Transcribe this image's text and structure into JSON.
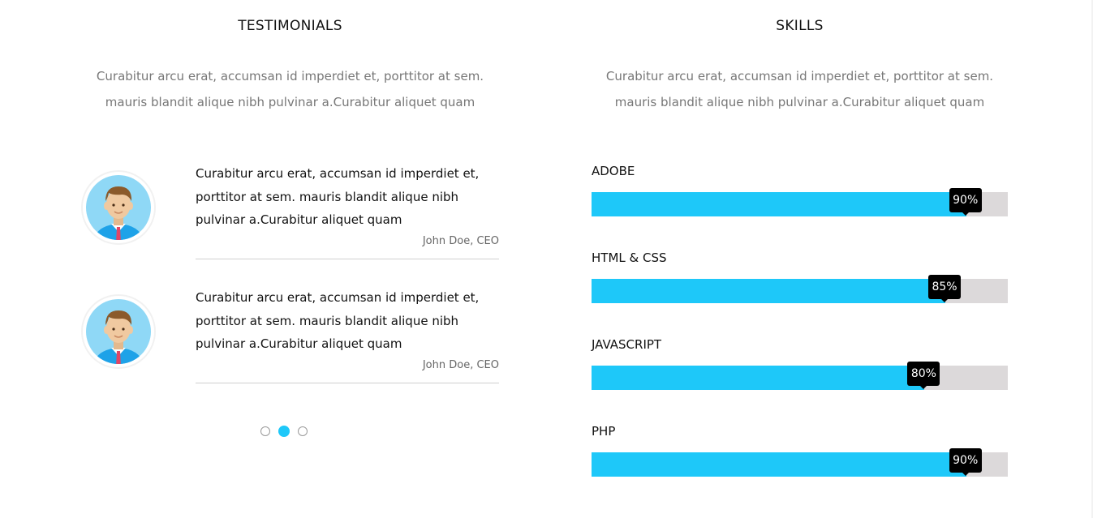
{
  "testimonials": {
    "title": "TESTIMONIALS",
    "intro_line1": "Curabitur arcu erat, accumsan id imperdiet et, porttitor at sem.",
    "intro_line2": "mauris blandit alique nibh pulvinar a.Curabitur aliquet quam",
    "items": [
      {
        "line1": "Curabitur arcu erat, accumsan id imperdiet et,",
        "line2": "porttitor at sem. mauris blandit alique nibh",
        "line3": "pulvinar a.Curabitur aliquet quam",
        "author": "John Doe, CEO"
      },
      {
        "line1": "Curabitur arcu erat, accumsan id imperdiet et,",
        "line2": "porttitor at sem. mauris blandit alique nibh",
        "line3": "pulvinar a.Curabitur aliquet quam",
        "author": "John Doe, CEO"
      }
    ],
    "pagination": {
      "count": 3,
      "active_index": 1
    }
  },
  "skills": {
    "title": "SKILLS",
    "intro_line1": "Curabitur arcu erat, accumsan id imperdiet et, porttitor at sem.",
    "intro_line2": "mauris blandit alique nibh pulvinar a.Curabitur aliquet quam",
    "items": [
      {
        "name": "ADOBE",
        "percent": 90,
        "label": "90%"
      },
      {
        "name": "HTML & CSS",
        "percent": 85,
        "label": "85%"
      },
      {
        "name": "JAVASCRIPT",
        "percent": 80,
        "label": "80%"
      },
      {
        "name": "PHP",
        "percent": 90,
        "label": "90%"
      }
    ]
  },
  "icons": {
    "avatar": "businessman-avatar-icon"
  },
  "colors": {
    "accent": "#1ec8f9",
    "bar_track": "#dcd9da",
    "bubble": "#000000",
    "avatar_bg": "#8fd8f6",
    "shirt": "#1ea2e8",
    "tie": "#e24566",
    "hair": "#8b5a2b",
    "skin": "#f0c9a0"
  }
}
